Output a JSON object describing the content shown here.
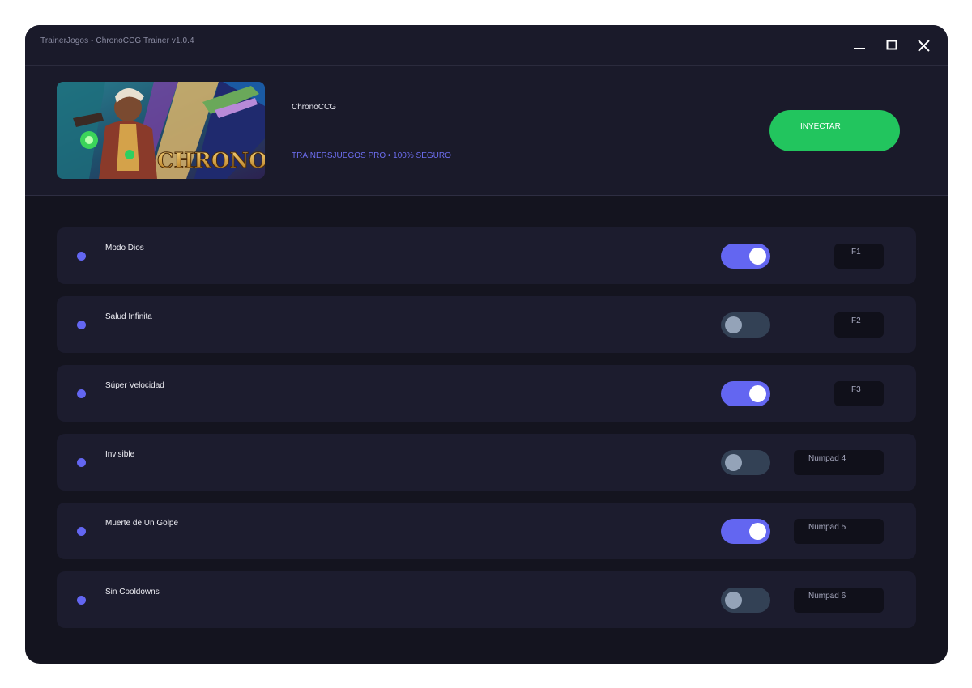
{
  "window": {
    "title": "TrainerJogos - ChronoCCG Trainer v1.0.4"
  },
  "header": {
    "game_name": "ChronoCCG",
    "tagline": "TRAINERSJUEGOS PRO • 100% SEGURO",
    "banner_logo_text": "CHRONO",
    "inject_label": "INYECTAR"
  },
  "colors": {
    "accent": "#6366f1",
    "inject": "#22c55e",
    "toggle_off": "#334155",
    "row_bg": "#1c1c2e",
    "window_bg": "#14141f"
  },
  "cheats": [
    {
      "label": "Modo Dios",
      "enabled": true,
      "hotkey": "F1"
    },
    {
      "label": "Salud Infinita",
      "enabled": false,
      "hotkey": "F2"
    },
    {
      "label": "Súper Velocidad",
      "enabled": true,
      "hotkey": "F3"
    },
    {
      "label": "Invisible",
      "enabled": false,
      "hotkey": "Numpad 4"
    },
    {
      "label": "Muerte de Un Golpe",
      "enabled": true,
      "hotkey": "Numpad 5"
    },
    {
      "label": "Sin Cooldowns",
      "enabled": false,
      "hotkey": "Numpad 6"
    }
  ]
}
